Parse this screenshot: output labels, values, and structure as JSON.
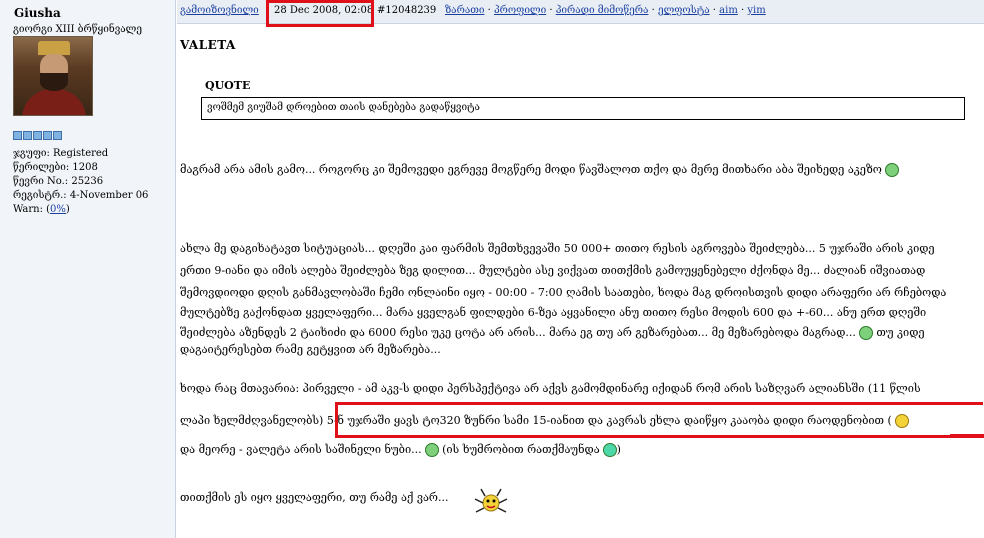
{
  "profile": {
    "username": "Giusha",
    "title": "გიორგი XIII ბრწყინვალე",
    "group_label": "ჯგუფი: Registered",
    "posts_label": "წერილები: 1208",
    "member_no_label": "წევრი No.: 25236",
    "registered_label": "რეგისტრ.: 4-November 06",
    "warn_prefix": "Warn: (",
    "warn_value": "0%",
    "warn_suffix": ")",
    "rating_pips": 5
  },
  "postbar": {
    "ignore_link": "გამოიზოვნილი",
    "date": "28 Dec 2008, 02:08",
    "post_id": "#12048239",
    "links": [
      "ზარათი",
      "პროფილი",
      "პირადი მიმოწერა",
      "ელფოსტა",
      "aim",
      "yim"
    ]
  },
  "post": {
    "title": "VALETA",
    "quote_label": "QUOTE",
    "quote_text": "ვოშმემ გიუშამ დროებით თაის დანებება გადაწყვიტა",
    "line1": "მაგრამ არა ამის გამო... როგორც კი შემოვედი ეგრევე მოგწერე მოდი წავშალოთ თქო და მერე მითხარი აბა შეიხედე აკეზო",
    "para": [
      "ახლა მე დაგიხატავთ სიტუაციას... დღეში კაი ფარმის შემთხვევაში 50 000+ თითო რესის აგროვება შეიძლება... 5 უჯრაში არის კიდე",
      "ერთი 9-იანი და იმის ალება შეიძლება ზეგ დილით... მულტები ასე ვიქვათ თითქმის გამოუყენებელი ძქონდა მე... ძალიან იშვიათად",
      "შემოვდიოდი დღის განმავლობაში ჩემი ონლაინი იყო - 00:00 - 7:00 ღამის საათები, ხოდა მაგ დროისთვის დიდი არაფერი არ რჩებოდა",
      "მულტებზე გაქონდათ ყველაფერი... მარა ყველგან ფილდები 6-ზეა აყვანილი ანუ თითო რესი მოდის 600 და +-60... ანუ ერთ დღეში",
      "შეიძლება აზენდეს 2 ტაიხიძი და 6000 რესი უკე ცოტა არ არის... მარა ეგ თუ არ გეზარებათ... მე მეზარებოდა მაგრად...",
      "დაგაიტერესებთ რამე გეტყვით არ მეზარება..."
    ],
    "para_smile_text": "თუ კიდე",
    "line_b1": "ხოდა რაც მთავარია: პირველი - ამ აკვ-ს დიდი პერსპექტივა არ აქვს გამომდინარე იქიდან რომ არის საზღვარ ალიანსში (11 წლის",
    "line_b2_start": "ლაპი ხელმძღვანელობს)",
    "line_b2_highlight": "5-ნ უჯრაში ყავს ტო320 ზუნრი სამი 15-იანით და კავრას ეხლა დაიწყო კააობა დიდი რაოდენობით",
    "line_b2_end": "(",
    "line_b3": "და მეორე - ვალეტა არის საშინელი ნუბი...",
    "line_b3_paren": "(ის ხუმრობით რათქმაუნდა",
    "line_b3_close": ")",
    "line_last": "თითქმის ეს იყო ყველაფერი, თუ რამე აქ ვარ..."
  },
  "colors": {
    "highlight": "#e0101a",
    "link": "#1a3fa0",
    "sidebar_bg": "#f1f4f8"
  }
}
